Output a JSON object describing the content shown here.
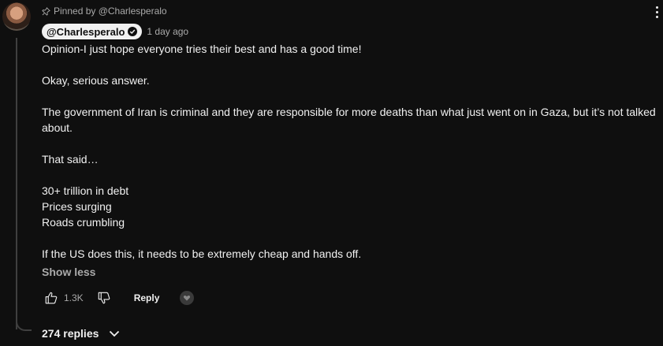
{
  "pinned_by": "Pinned by @Charlesperalo",
  "author": "@Charlesperalo",
  "timestamp": "1 day ago",
  "comment": {
    "lines": [
      "Opinion-I just hope everyone tries their best and has a good time!",
      "",
      "Okay, serious answer.",
      "",
      "The government of Iran is criminal and they are responsible for more deaths than what just went on in Gaza, but it’s not talked about.",
      "",
      "That said…",
      "",
      "30+ trillion in debt",
      "Prices surging",
      "Roads crumbling",
      "",
      "If the US does this, it needs to be extremely cheap and hands off."
    ]
  },
  "show_less": "Show less",
  "likes": "1.3K",
  "reply_label": "Reply",
  "replies_label": "274 replies",
  "icons": {
    "pin": "pin-icon",
    "verified": "verified-check-icon",
    "like": "thumbs-up-icon",
    "dislike": "thumbs-down-icon",
    "more": "more-vertical-icon",
    "expand": "chevron-down-icon"
  }
}
